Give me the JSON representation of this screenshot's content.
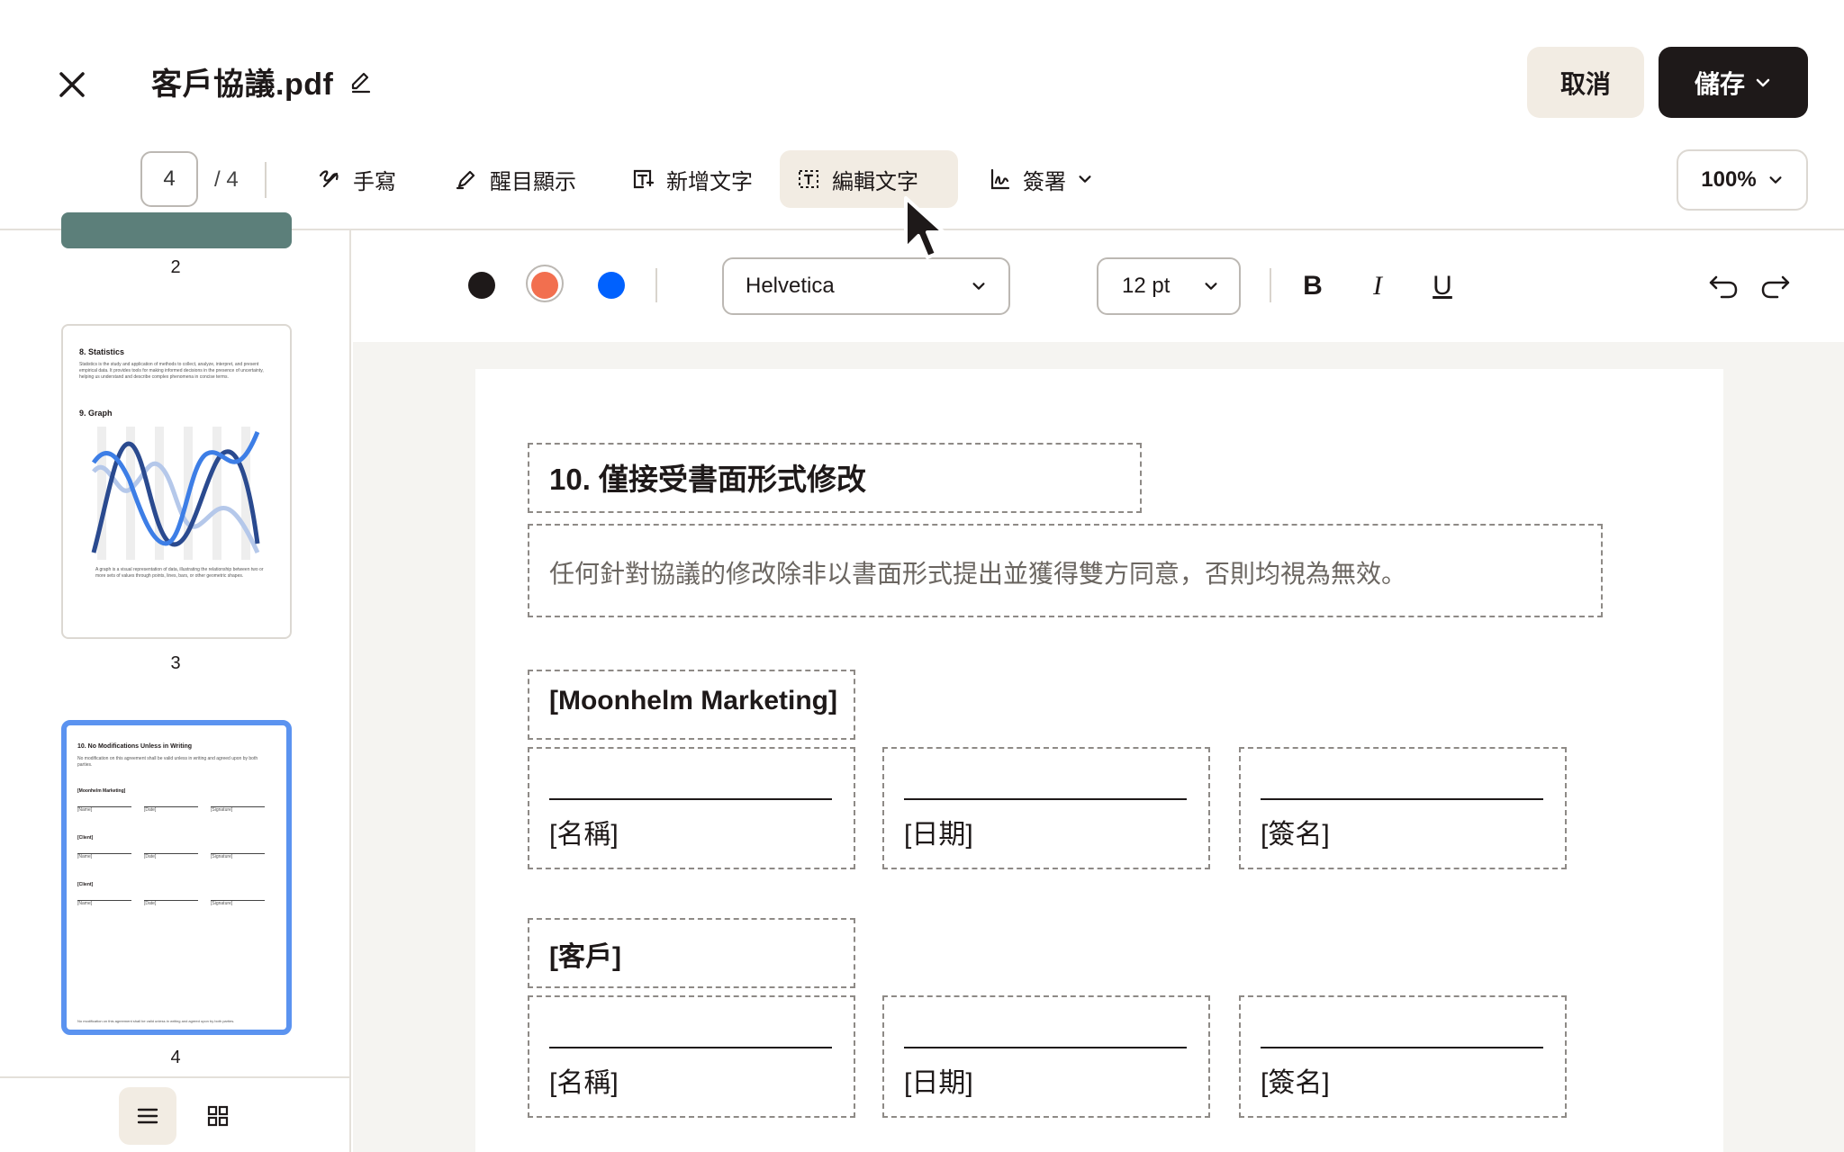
{
  "header": {
    "title": "客戶協議.pdf",
    "cancel_label": "取消",
    "save_label": "儲存"
  },
  "toolbar": {
    "page_current": "4",
    "page_total": "/ 4",
    "tools": [
      {
        "label": "手寫",
        "icon": "handwriting-icon"
      },
      {
        "label": "醒目顯示",
        "icon": "highlighter-icon"
      },
      {
        "label": "新增文字",
        "icon": "add-text-icon"
      },
      {
        "label": "編輯文字",
        "icon": "edit-text-icon",
        "active": true
      },
      {
        "label": "簽署",
        "icon": "sign-icon"
      }
    ],
    "zoom": "100%"
  },
  "format_bar": {
    "colors": [
      "#1e1919",
      "#f26f4f",
      "#0061fe"
    ],
    "font": "Helvetica",
    "size": "12 pt",
    "bold": "B",
    "italic": "I",
    "underline": "U"
  },
  "sidebar": {
    "pages": [
      {
        "number": "2"
      },
      {
        "number": "3",
        "heading1": "8. Statistics",
        "text1": "Statistics is the study and application of methods to collect, analyze, interpret, and present empirical data. It provides tools for making informed decisions in the presence of uncertainty, helping us understand and describe complex phenomena in concise terms.",
        "heading2": "9. Graph",
        "text2": "A graph is a visual representation of data, illustrating the relationship between two or more sets of values through points, lines, bars, or other geometric shapes."
      },
      {
        "number": "4",
        "selected": true,
        "heading": "10. No Modifications Unless in Writing",
        "text": "No modification on this agreement shall be valid unless in writing and agreed upon by both parties.",
        "party1": "[Moonhelm Marketing]",
        "party2": "[Client]",
        "party3": "[Client]",
        "name": "[Name]",
        "date": "[Date]",
        "signature": "[Signature]",
        "footer": "No modification on this agreement shall be valid unless in writing and agreed upon by both parties."
      }
    ]
  },
  "document": {
    "heading": "10. 僅接受書面形式修改",
    "body": "任何針對協議的修改除非以書面形式提出並獲得雙方同意，否則均視為無效。",
    "party1": "[Moonhelm Marketing]",
    "party2": "[客戶]",
    "name_label": "[名稱]",
    "date_label": "[日期]",
    "signature_label": "[簽名]"
  }
}
